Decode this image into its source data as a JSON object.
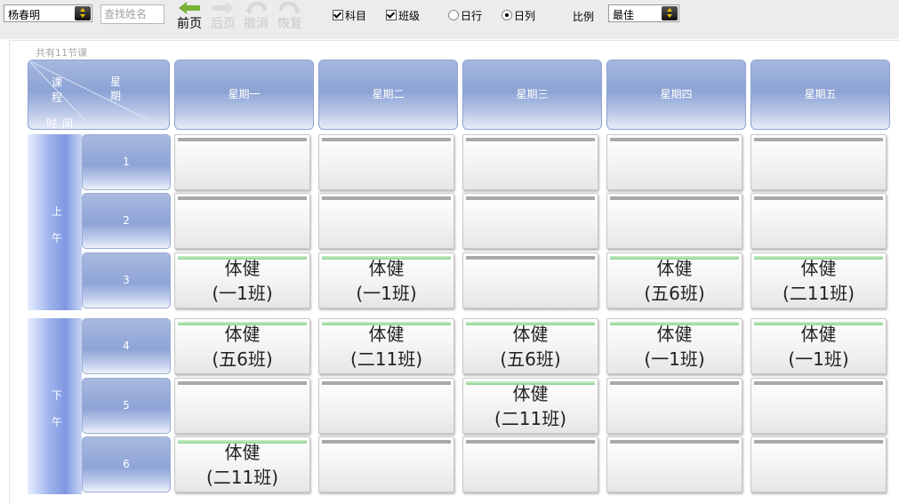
{
  "toolbar": {
    "teacher_value": "杨春明",
    "search_placeholder": "查找姓名",
    "nav": {
      "prev": "前页",
      "next": "后页",
      "undo": "撤消",
      "redo": "恢复"
    },
    "options": {
      "subject": {
        "label": "科目",
        "checked": true
      },
      "class": {
        "label": "班级",
        "checked": true
      },
      "daily_row": {
        "label": "日行",
        "selected": false
      },
      "daily_column": {
        "label": "日列",
        "selected": true
      }
    },
    "ratio_label": "比例",
    "ratio_value": "最佳"
  },
  "timetable": {
    "count_text": "共有11节课",
    "corner": {
      "lesson": "课程",
      "day": "星期",
      "time": "时间"
    },
    "days": [
      "星期一",
      "星期二",
      "星期三",
      "星期四",
      "星期五"
    ],
    "periods": [
      {
        "label": "上午",
        "lessons": [
          "1",
          "2",
          "3"
        ]
      },
      {
        "label": "下午",
        "lessons": [
          "4",
          "5",
          "6"
        ]
      }
    ],
    "rows": [
      [
        {
          "subject": "",
          "class": ""
        },
        {
          "subject": "",
          "class": ""
        },
        {
          "subject": "",
          "class": ""
        },
        {
          "subject": "",
          "class": ""
        },
        {
          "subject": "",
          "class": ""
        }
      ],
      [
        {
          "subject": "",
          "class": ""
        },
        {
          "subject": "",
          "class": ""
        },
        {
          "subject": "",
          "class": ""
        },
        {
          "subject": "",
          "class": ""
        },
        {
          "subject": "",
          "class": ""
        }
      ],
      [
        {
          "subject": "体健",
          "class": "(一1班)"
        },
        {
          "subject": "体健",
          "class": "(一1班)"
        },
        {
          "subject": "",
          "class": ""
        },
        {
          "subject": "体健",
          "class": "(五6班)"
        },
        {
          "subject": "体健",
          "class": "(二11班)"
        }
      ],
      [
        {
          "subject": "体健",
          "class": "(五6班)"
        },
        {
          "subject": "体健",
          "class": "(二11班)"
        },
        {
          "subject": "体健",
          "class": "(五6班)"
        },
        {
          "subject": "体健",
          "class": "(一1班)"
        },
        {
          "subject": "体健",
          "class": "(一1班)"
        }
      ],
      [
        {
          "subject": "",
          "class": ""
        },
        {
          "subject": "",
          "class": ""
        },
        {
          "subject": "体健",
          "class": "(二11班)"
        },
        {
          "subject": "",
          "class": ""
        },
        {
          "subject": "",
          "class": ""
        }
      ],
      [
        {
          "subject": "体健",
          "class": "(二11班)"
        },
        {
          "subject": "",
          "class": ""
        },
        {
          "subject": "",
          "class": ""
        },
        {
          "subject": "",
          "class": ""
        },
        {
          "subject": "",
          "class": ""
        }
      ]
    ]
  },
  "colors": {
    "header_blue": "#8ca3d4",
    "filled_strip": "#8dd28d",
    "empty_strip": "#a9a9a9",
    "nav_arrow": "#7ab33a"
  }
}
